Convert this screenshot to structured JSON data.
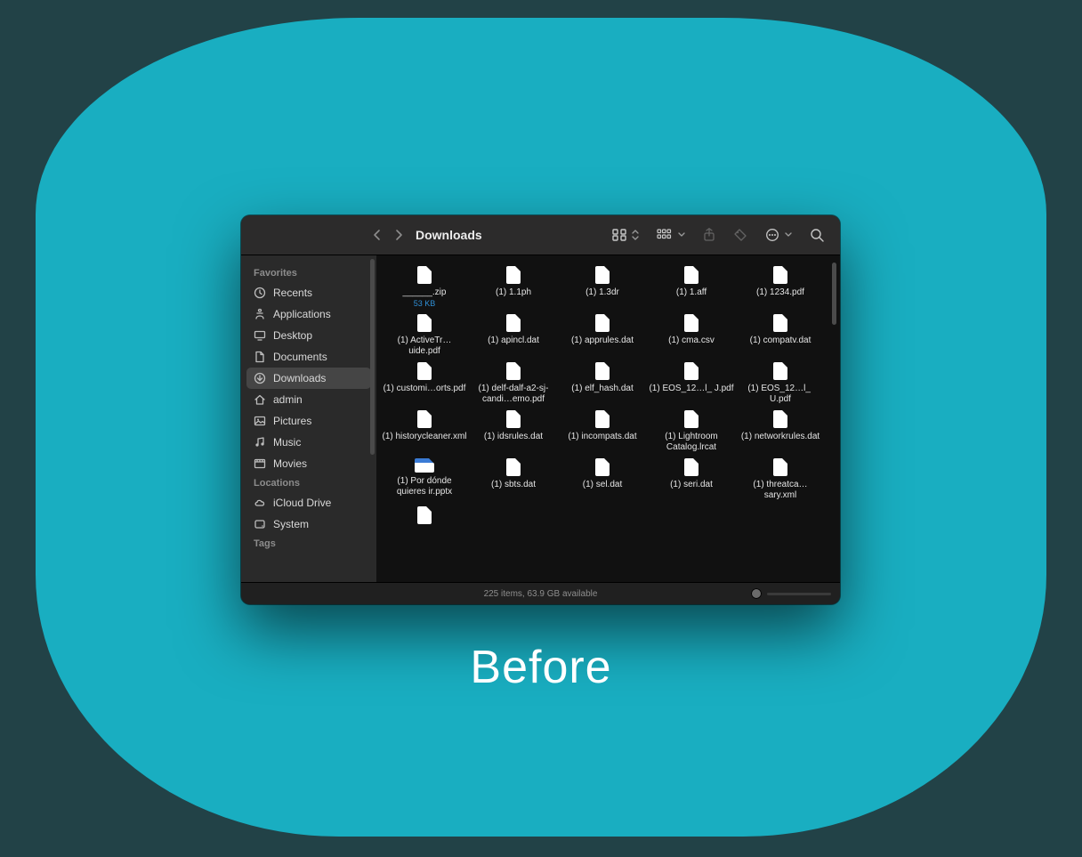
{
  "caption": "Before",
  "window": {
    "title": "Downloads"
  },
  "sidebar": {
    "sections": [
      {
        "label": "Favorites",
        "items": [
          {
            "icon": "clock",
            "label": "Recents"
          },
          {
            "icon": "apps",
            "label": "Applications"
          },
          {
            "icon": "desktop",
            "label": "Desktop"
          },
          {
            "icon": "doc",
            "label": "Documents"
          },
          {
            "icon": "download",
            "label": "Downloads",
            "active": true
          },
          {
            "icon": "home",
            "label": "admin"
          },
          {
            "icon": "picture",
            "label": "Pictures"
          },
          {
            "icon": "music",
            "label": "Music"
          },
          {
            "icon": "movie",
            "label": "Movies"
          }
        ]
      },
      {
        "label": "Locations",
        "items": [
          {
            "icon": "cloud",
            "label": "iCloud Drive"
          },
          {
            "icon": "disk",
            "label": "System"
          }
        ]
      },
      {
        "label": "Tags",
        "items": []
      }
    ]
  },
  "files": {
    "rows": [
      [
        {
          "name": "______.zip",
          "sub": "53 KB"
        },
        {
          "name": "(1) 1.1ph"
        },
        {
          "name": "(1) 1.3dr"
        },
        {
          "name": "(1) 1.aff"
        },
        {
          "name": "(1) 1234.pdf"
        }
      ],
      [
        {
          "name": "(1) ActiveTr…uide.pdf"
        },
        {
          "name": "(1) apincl.dat"
        },
        {
          "name": "(1) apprules.dat"
        },
        {
          "name": "(1) cma.csv"
        },
        {
          "name": "(1) compatv.dat"
        }
      ],
      [
        {
          "name": "(1) customi…orts.pdf"
        },
        {
          "name": "(1) delf-dalf-a2-sj-candi…emo.pdf"
        },
        {
          "name": "(1) elf_hash.dat"
        },
        {
          "name": "(1) EOS_12…l_ J.pdf"
        },
        {
          "name": "(1) EOS_12…l_ U.pdf"
        }
      ],
      [
        {
          "name": "(1) historycleaner.xml"
        },
        {
          "name": "(1) idsrules.dat"
        },
        {
          "name": "(1) incompats.dat"
        },
        {
          "name": "(1) Lightroom Catalog.lrcat"
        },
        {
          "name": "(1) networkrules.dat"
        }
      ],
      [
        {
          "name": "(1) Por dónde quieres ir.pptx",
          "type": "pptx"
        },
        {
          "name": "(1) sbts.dat"
        },
        {
          "name": "(1) sel.dat"
        },
        {
          "name": "(1) seri.dat"
        },
        {
          "name": "(1) threatca…sary.xml"
        }
      ],
      [
        {
          "name": ""
        }
      ]
    ]
  },
  "status": {
    "text": "225 items, 63.9 GB available"
  }
}
